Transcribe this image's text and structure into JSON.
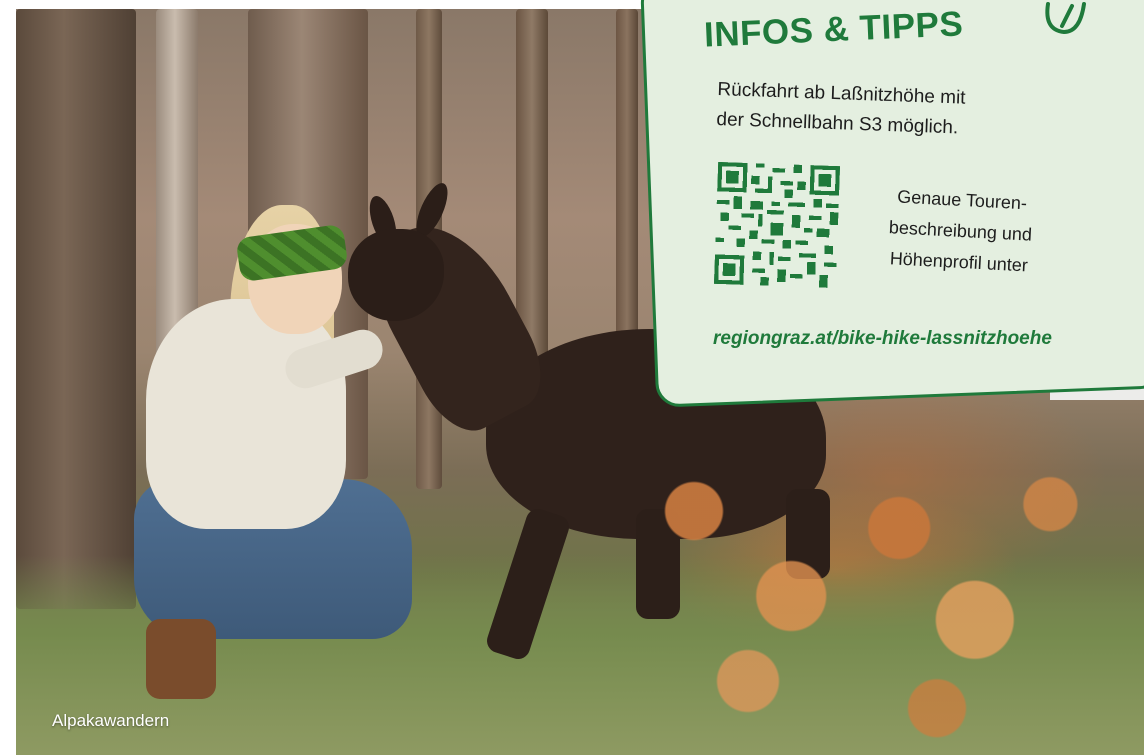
{
  "photo": {
    "caption": "Alpakawandern"
  },
  "info_card": {
    "title": "INFOS & TIPPS",
    "text_line1": "Rückfahrt ab Laßnitzhöhe mit",
    "text_line2": "der Schnellbahn S3 möglich.",
    "qr_text_line1": "Genaue Touren-",
    "qr_text_line2": "beschreibung und",
    "qr_text_line3": "Höhenprofil unter",
    "link": "regiongraz.at/bike-hike-lassnitzhoehe",
    "icon": "pencil-icon",
    "accent_color": "#1f7a3b",
    "background_color": "#e4efe0"
  }
}
